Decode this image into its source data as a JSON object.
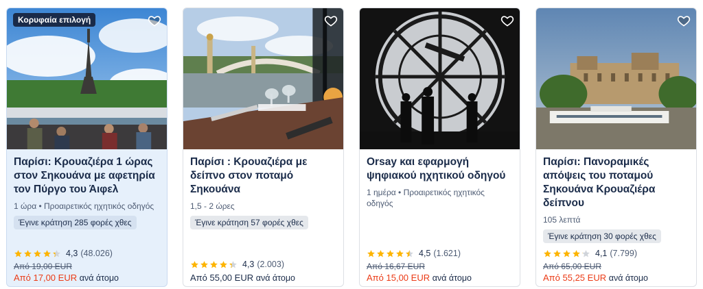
{
  "colors": {
    "accent_sale": "#eb3a15",
    "star": "#fdb400",
    "text": "#1a2b49",
    "highlight_bg": "#e6f0fb"
  },
  "cards": [
    {
      "badge": "Κορυφαία επιλογή",
      "title": "Παρίσι: Κρουαζιέρα 1 ώρας στον Σηκουάνα με αφετηρία τον Πύργο του Άιφελ",
      "meta": "1 ώρα • Προαιρετικός ηχητικός οδηγός",
      "booked": "Έγινε κράτηση 285 φορές χθες",
      "rating": "4,3",
      "rating_count": "(48.026)",
      "rating_value": 4.3,
      "old_price": "Από 19,00 EUR",
      "price_prefix": "Από",
      "price": "17,00 EUR",
      "per_person": "ανά άτομο"
    },
    {
      "title": "Παρίσι : Κρουαζιέρα με δείπνο στον ποταμό Σηκουάνα",
      "meta": "1,5 - 2 ώρες",
      "booked": "Έγινε κράτηση 57 φορές χθες",
      "rating": "4,3",
      "rating_count": "(2.003)",
      "rating_value": 4.3,
      "old_price": "",
      "price_prefix": "Από",
      "price": "55,00 EUR",
      "per_person": "ανά άτομο"
    },
    {
      "title": "Orsay και εφαρμογή ψηφιακού ηχητικού οδηγού",
      "meta": "1 ημέρα • Προαιρετικός ηχητικός οδηγός",
      "booked": "",
      "rating": "4,5",
      "rating_count": "(1.621)",
      "rating_value": 4.5,
      "old_price": "Από 16,67 EUR",
      "price_prefix": "Από",
      "price": "15,00 EUR",
      "per_person": "ανά άτομο"
    },
    {
      "title": "Παρίσι: Πανοραμικές απόψεις του ποταμού Σηκουάνα Κρουαζιέρα δείπνου",
      "meta": "105 λεπτά",
      "booked": "Έγινε κράτηση 30 φορές χθες",
      "rating": "4,1",
      "rating_count": "(7.799)",
      "rating_value": 4.1,
      "old_price": "Από 65,00 EUR",
      "price_prefix": "Από",
      "price": "55,25 EUR",
      "per_person": "ανά άτομο"
    }
  ]
}
